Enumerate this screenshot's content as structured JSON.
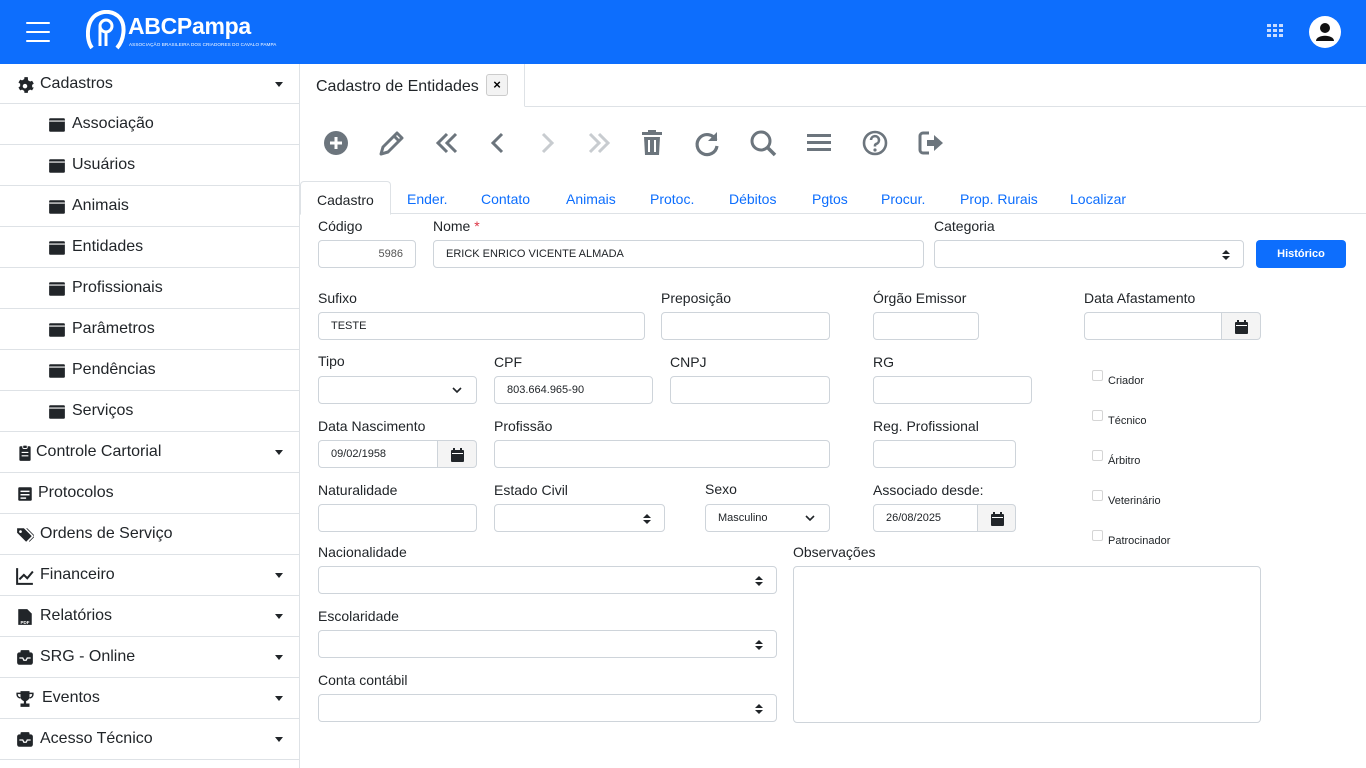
{
  "header": {
    "logo_name": "ABCPampa",
    "logo_subtitle": "ASSOCIAÇÃO BRASILEIRA DOS CRIADORES DO CAVALO PAMPA"
  },
  "sidebar": {
    "items": [
      {
        "label": "Cadastros",
        "icon": "gear-icon",
        "caret": true
      },
      {
        "label": "Associação",
        "icon": "folder-icon"
      },
      {
        "label": "Usuários",
        "icon": "folder-icon"
      },
      {
        "label": "Animais",
        "icon": "folder-icon"
      },
      {
        "label": "Entidades",
        "icon": "folder-icon"
      },
      {
        "label": "Profissionais",
        "icon": "folder-icon"
      },
      {
        "label": "Parâmetros",
        "icon": "folder-icon"
      },
      {
        "label": "Pendências",
        "icon": "folder-icon"
      },
      {
        "label": "Serviços",
        "icon": "folder-icon"
      },
      {
        "label": "Controle Cartorial",
        "icon": "clipboard-icon",
        "caret": true
      },
      {
        "label": "Protocolos",
        "icon": "document-icon"
      },
      {
        "label": "Ordens de Serviço",
        "icon": "tags-icon"
      },
      {
        "label": "Financeiro",
        "icon": "line-chart-icon",
        "caret": true
      },
      {
        "label": "Relatórios",
        "icon": "pdf-file-icon",
        "caret": true
      },
      {
        "label": "SRG - Online",
        "icon": "inbox-icon",
        "caret": true
      },
      {
        "label": "Eventos",
        "icon": "trophy-icon",
        "caret": true
      },
      {
        "label": "Acesso Técnico",
        "icon": "inbox-icon",
        "caret": true
      }
    ]
  },
  "doc_tab": {
    "label": "Cadastro de Entidades",
    "close": "×"
  },
  "toolbar": [
    "add-icon",
    "edit-icon",
    "first-icon",
    "previous-icon",
    "next-icon",
    "last-icon",
    "delete-icon",
    "refresh-icon",
    "search-icon",
    "list-icon",
    "help-icon",
    "exit-icon"
  ],
  "tabs": [
    "Cadastro",
    "Ender.",
    "Contato",
    "Animais",
    "Protoc.",
    "Débitos",
    "Pgtos",
    "Procur.",
    "Prop. Rurais",
    "Localizar"
  ],
  "form": {
    "codigo": {
      "label": "Código",
      "value": "5986"
    },
    "nome": {
      "label": "Nome",
      "required": "*",
      "value": "ERICK ENRICO VICENTE ALMADA"
    },
    "categoria": {
      "label": "Categoria",
      "value": ""
    },
    "historico_button": "Histórico",
    "sufixo": {
      "label": "Sufixo",
      "value": "TESTE"
    },
    "preposicao": {
      "label": "Preposição",
      "value": ""
    },
    "orgao_emissor": {
      "label": "Órgão Emissor",
      "value": ""
    },
    "data_afastamento": {
      "label": "Data Afastamento",
      "value": ""
    },
    "tipo": {
      "label": "Tipo",
      "value": ""
    },
    "cpf": {
      "label": "CPF",
      "value": "803.664.965-90"
    },
    "cnpj": {
      "label": "CNPJ",
      "value": ""
    },
    "rg": {
      "label": "RG",
      "value": ""
    },
    "data_nascimento": {
      "label": "Data Nascimento",
      "value": "09/02/1958"
    },
    "profissao": {
      "label": "Profissão",
      "value": ""
    },
    "reg_profissional": {
      "label": "Reg. Profissional",
      "value": ""
    },
    "naturalidade": {
      "label": "Naturalidade",
      "value": ""
    },
    "estado_civil": {
      "label": "Estado Civil",
      "value": ""
    },
    "sexo": {
      "label": "Sexo",
      "value": "Masculino"
    },
    "associado_desde": {
      "label": "Associado desde:",
      "value": "26/08/2025"
    },
    "nacionalidade": {
      "label": "Nacionalidade",
      "value": ""
    },
    "observacoes": {
      "label": "Observações",
      "value": ""
    },
    "escolaridade": {
      "label": "Escolaridade",
      "value": ""
    },
    "conta_contabil": {
      "label": "Conta contábil",
      "value": ""
    },
    "checkboxes": [
      "Criador",
      "Técnico",
      "Árbitro",
      "Veterinário",
      "Patrocinador"
    ]
  },
  "colors": {
    "primary": "#0d6efd",
    "icon_gray": "#6c757d",
    "icon_disabled": "#c8ccd0"
  }
}
